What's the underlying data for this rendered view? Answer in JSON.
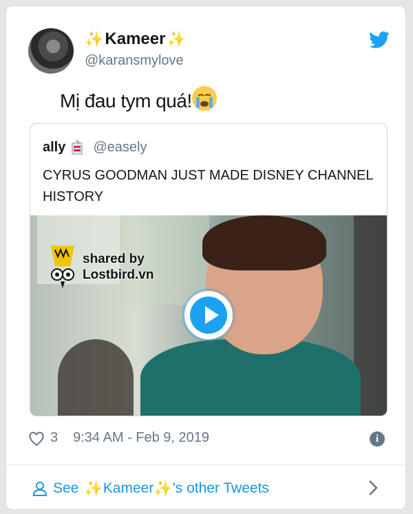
{
  "tweet": {
    "display_name_core": "Kameer",
    "sparkle_glyph": "✨",
    "handle": "@karansmylove",
    "text": "Mị đau tym quá!",
    "likes": "3",
    "timestamp": "9:34 AM - Feb 9, 2019"
  },
  "quoted": {
    "name": "ally",
    "handle": "@easely",
    "text": "CYRUS GOODMAN JUST MADE DISNEY CHANNEL HISTORY"
  },
  "watermark": {
    "line1": "shared by",
    "line2": "Lostbird.vn"
  },
  "footer": {
    "see_prefix": "See",
    "see_suffix": "'s other Tweets"
  },
  "icons": {
    "twitter": "twitter-bird-icon",
    "like": "heart-icon",
    "info": "info-icon",
    "user": "person-icon",
    "more": "chevron-right-icon"
  },
  "colors": {
    "accent": "#1da1f2",
    "link": "#1b95e0",
    "muted": "#657786"
  }
}
